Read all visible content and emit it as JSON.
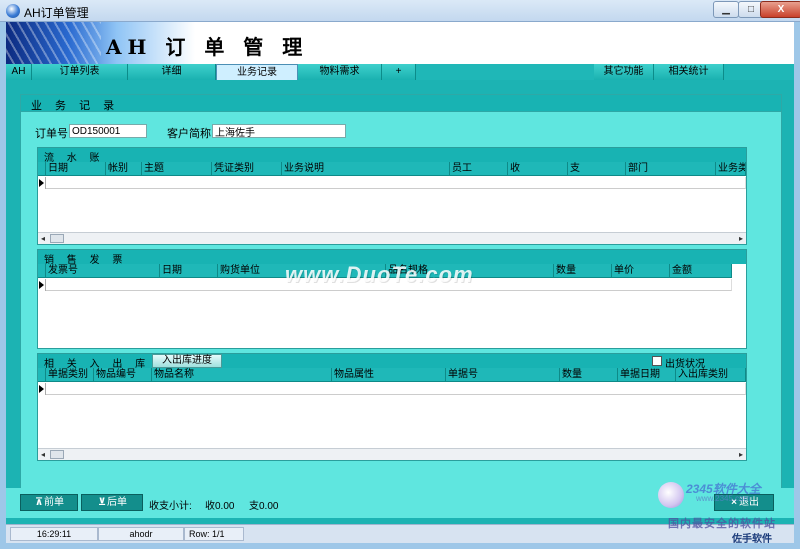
{
  "window": {
    "title": "AH订单管理",
    "controls": {
      "minimize": "▁",
      "maximize": "□",
      "close": "X"
    }
  },
  "banner": {
    "title": "AH 订 单 管 理"
  },
  "tabs": [
    {
      "label": "AH"
    },
    {
      "label": "订单列表"
    },
    {
      "label": "详细"
    },
    {
      "label": "业务记录",
      "active": true
    },
    {
      "label": "物料需求"
    },
    {
      "label": "+"
    },
    {
      "label": "其它功能"
    },
    {
      "label": "相关统计"
    }
  ],
  "panel": {
    "title": "业 务 记 录",
    "order_no_label": "订单号",
    "order_no_value": "OD150001",
    "customer_label": "客户简称",
    "customer_value": "上海佐手"
  },
  "ledger": {
    "title": "流 水 账",
    "columns": [
      "日期",
      "帐别",
      "主题",
      "凭证类别",
      "业务说明",
      "员工",
      "收",
      "支",
      "部门",
      "业务类"
    ]
  },
  "invoice": {
    "title": "销 售 发 票",
    "columns": [
      "发票号",
      "日期",
      "购货单位",
      "品名规格",
      "数量",
      "单价",
      "金额"
    ]
  },
  "inout": {
    "title": "相 关 入 出 库",
    "progress_button": "入出库进度",
    "shipping_status_label": "出货状况",
    "columns": [
      "单据类别",
      "物品编号",
      "物品名称",
      "物品属性",
      "单据号",
      "数量",
      "单据日期",
      "入出库类别"
    ]
  },
  "bottom": {
    "prev_label": "前单",
    "next_label": "后单",
    "summary_label": "收支小计:",
    "income_text": "收0.00",
    "expense_text": "支0.00",
    "exit_label": "退出"
  },
  "status": {
    "time": "16:29:11",
    "user": "ahodr",
    "rows": "Row: 1/1"
  },
  "watermark": {
    "site": "www.DuoTe.com",
    "brand_line1": "2345软件大全",
    "brand_line2": "www.2345.com",
    "brand_line3": "国内最安全的软件站",
    "brand_line4": "佐手软件"
  },
  "colors": {
    "teal_header": "#18b3b3",
    "panel_bg": "#5fe6df",
    "button_dark": "#138e8c"
  }
}
